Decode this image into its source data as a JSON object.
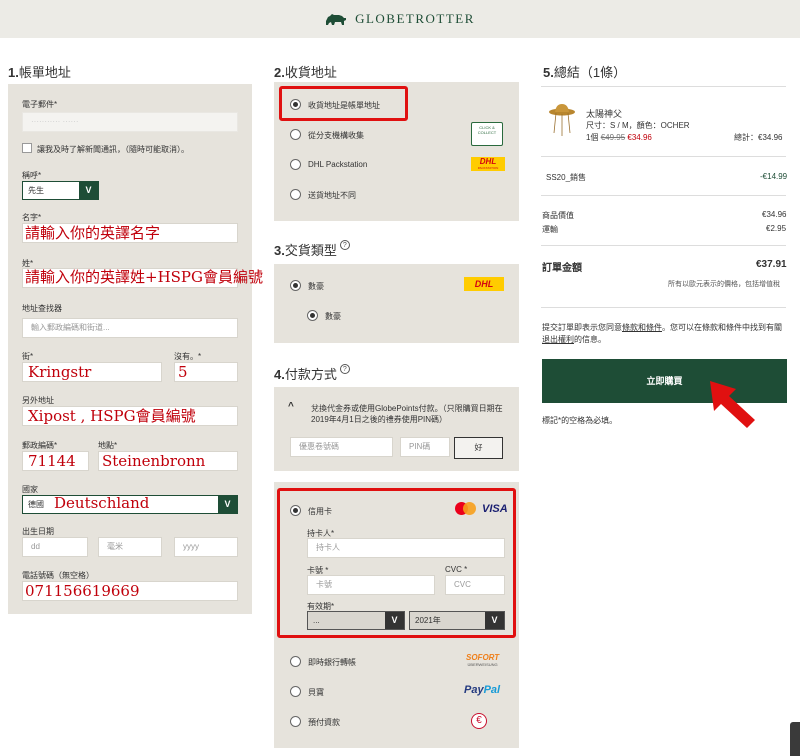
{
  "header": {
    "brand": "GLOBETROTTER"
  },
  "billing": {
    "title_num": "1.",
    "title": "帳單地址",
    "email_label": "電子郵件*",
    "email_value": "··········· ······",
    "newsletter_label": "讓我及時了解新聞通訊，（隨時可能取消）。",
    "salutation_label": "稱呼*",
    "salutation_value": "先生",
    "firstname_label": "名字*",
    "firstname_overlay": "請輸入你的英譯名字",
    "lastname_label": "姓*",
    "lastname_overlay": "請輸入你的英譯姓+HSPG會員編號",
    "address_finder_label": "地址查找器",
    "address_finder_placeholder": "輸入郵政編碼和街道...",
    "street_label": "街*",
    "street_overlay": "Kringstr",
    "number_label": "沒有。*",
    "number_overlay": "5",
    "extra_label": "另外地址",
    "extra_overlay": "Xipost , HSPG會員編號",
    "zip_label": "郵政編碼*",
    "zip_overlay": "71144",
    "city_label": "地點*",
    "city_overlay": "Steinenbronn",
    "country_label": "國家",
    "country_value": "德國",
    "country_overlay": "Deutschland",
    "dob_label": "出生日期",
    "dob_dd": "dd",
    "dob_mm": "毫米",
    "dob_yyyy": "yyyy",
    "phone_label": "電話號碼（無空格）",
    "phone_overlay": "071156619669",
    "select_arrow": "V"
  },
  "shipping": {
    "title_num": "2.",
    "title": "收貨地址",
    "options": [
      "收貨地址是帳單地址",
      "從分支機構收集",
      "DHL Packstation",
      "送貨地址不同"
    ],
    "click_collect": "CLICK & COLLECT",
    "dhl": "DHL",
    "packstation": "PACKSTATION"
  },
  "delivery": {
    "title_num": "3.",
    "title": "交貨類型",
    "option": "數豪",
    "sub_option": "數豪",
    "help": "?"
  },
  "payment": {
    "title_num": "4.",
    "title": "付款方式",
    "help": "?",
    "voucher_chevron": "^",
    "voucher_text": "兌換代金券或使用GlobePoints付款。（只限購買日期在2019年4月1日之後的禮券使用PIN碼）",
    "voucher_placeholder": "優惠卷號碼",
    "pin_placeholder": "PIN碼",
    "ok_label": "好",
    "credit_card": "信用卡",
    "mastercard": "mastercard",
    "visa": "VISA",
    "holder_label": "持卡人*",
    "holder_placeholder": "持卡人",
    "card_label": "卡號 *",
    "card_placeholder": "卡號",
    "cvc_label": "CVC *",
    "cvc_placeholder": "CVC",
    "expiry_label": "有效期*",
    "expiry_month": "...",
    "expiry_year": "2021年",
    "select_arrow": "V",
    "sofort_option": "即時銀行轉帳",
    "sofort_logo": "SOFORT",
    "sofort_sub": "ÜBERWEISUNG",
    "paypal_option": "貝寶",
    "paypal_logo_a": "Pay",
    "paypal_logo_b": "Pal",
    "prepay_option": "預付資款",
    "euro": "€"
  },
  "summary": {
    "title_num": "5.",
    "title": "總結（1條）",
    "product_name": "太陽神父",
    "product_variant": "尺寸：S / M，顏色：OCHER",
    "product_qty": "1個",
    "product_old_price": "€49.95",
    "product_new_price": "€34.96",
    "product_total": "總計：€34.96",
    "discount_label": "SS20_銷售",
    "discount_value": "-€14.99",
    "goods_label": "商品價值",
    "goods_value": "€34.96",
    "shipping_label": "運輸",
    "shipping_value": "€2.95",
    "total_label": "訂單金額",
    "total_value": "€37.91",
    "vat_note": "所有以歐元表示的價格，包括增值稅",
    "terms_text_1": "提交訂單即表示您同意",
    "terms_link": "條款和條件",
    "terms_text_2": "。您可以在條款和條件中找到有關",
    "withdraw_link": "退出權利",
    "terms_text_3": "的信息。",
    "buy_button": "立即購買",
    "required_note": "標記*的空格為必填。"
  },
  "colors": {
    "brand_green": "#1e4d36",
    "panel_bg": "#e6e3dc",
    "highlight_red": "#e01010",
    "sale_red": "#c0000b"
  }
}
